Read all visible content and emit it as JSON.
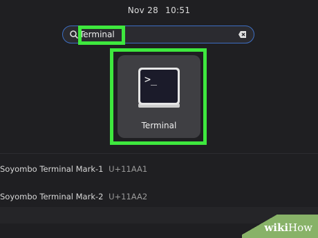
{
  "topbar": {
    "date": "Nov 28",
    "time": "10:51"
  },
  "search": {
    "value": "Terminal"
  },
  "app": {
    "label": "Terminal",
    "prompt": ">_"
  },
  "results": [
    {
      "name": "Soyombo Terminal Mark-1",
      "code": "U+11AA1"
    },
    {
      "name": "Soyombo Terminal Mark-2",
      "code": "U+11AA2"
    }
  ],
  "watermark": {
    "bold": "wiki",
    "light": "How"
  },
  "colors": {
    "highlight": "#3ee83e",
    "search_border": "#3d6fc4",
    "background": "#1f1f22"
  },
  "icons": [
    "search-icon",
    "clear-search-icon",
    "terminal-app-icon"
  ]
}
